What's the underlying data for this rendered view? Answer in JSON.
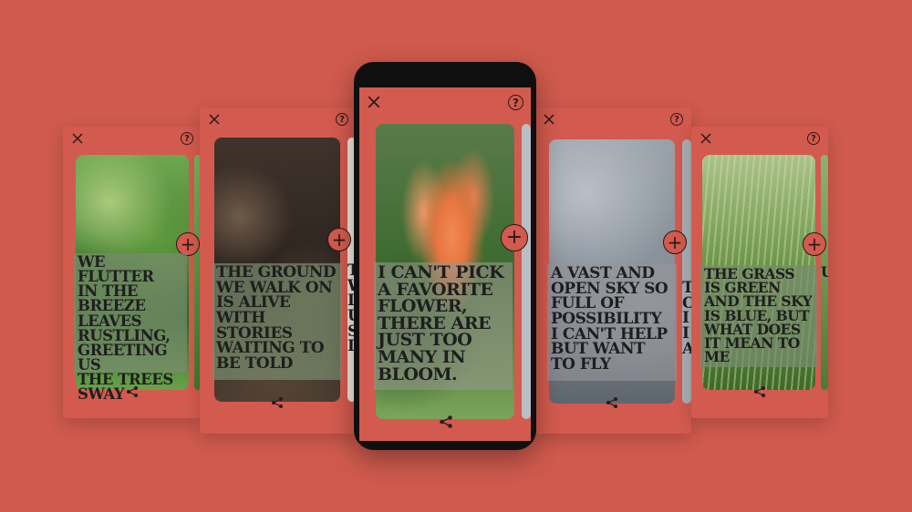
{
  "colors": {
    "background": "#cf5a4d",
    "card": "#d35a4e",
    "ink": "#1e1e1e",
    "phone": "#0f0f0f"
  },
  "icons": {
    "close": "close-icon",
    "help": "help-icon",
    "add": "plus-icon",
    "share": "share-icon"
  },
  "cards": [
    {
      "id": "breeze",
      "caption_lines": [
        "WE FLUTTER",
        "IN THE",
        "BREEZE",
        "LEAVES",
        "RUSTLING,",
        "GREETING US",
        "THE TREES",
        "SWAY"
      ],
      "help_label": "?"
    },
    {
      "id": "ground",
      "caption_lines": [
        "THE GROUND",
        "WE WALK ON",
        "IS ALIVE",
        "WITH",
        "STORIES",
        "WAITING TO",
        "BE TOLD"
      ],
      "help_label": "?"
    },
    {
      "id": "flower",
      "caption_lines": [
        "I CAN'T PICK",
        "A FAVORITE",
        "FLOWER,",
        "THERE ARE",
        "JUST TOO",
        "MANY IN",
        "BLOOM."
      ],
      "help_label": "?"
    },
    {
      "id": "sky",
      "caption_lines": [
        "A VAST AND",
        "OPEN SKY SO",
        "FULL OF",
        "POSSIBILITY",
        "I CAN'T HELP",
        "BUT WANT",
        "TO FLY"
      ],
      "help_label": "?"
    },
    {
      "id": "grass",
      "caption_lines": [
        "THE GRASS",
        "IS GREEN",
        "AND THE SKY",
        "IS BLUE, BUT",
        "WHAT DOES",
        "IT MEAN TO",
        "ME"
      ],
      "help_label": "?"
    }
  ],
  "peek_letters": {
    "ground": [
      "T",
      "W",
      "I",
      "",
      "U",
      "S",
      "I"
    ],
    "sky": [
      "T",
      "O",
      "I",
      "I",
      "A"
    ],
    "grass": [
      "",
      "",
      "",
      "",
      "",
      "",
      "U"
    ]
  }
}
